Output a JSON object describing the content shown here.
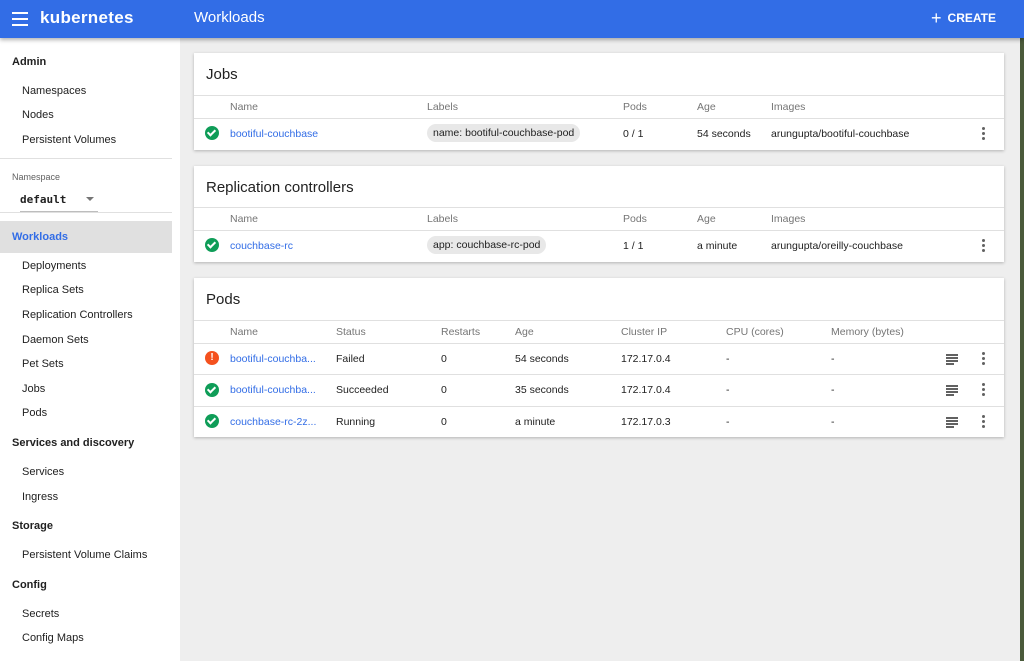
{
  "app": {
    "logo": "kubernetes",
    "page_title": "Workloads",
    "create_label": "CREATE"
  },
  "sidebar": {
    "admin": {
      "title": "Admin",
      "items": [
        "Namespaces",
        "Nodes",
        "Persistent Volumes"
      ]
    },
    "namespace": {
      "label": "Namespace",
      "value": "default"
    },
    "workloads": {
      "title": "Workloads",
      "items": [
        "Deployments",
        "Replica Sets",
        "Replication Controllers",
        "Daemon Sets",
        "Pet Sets",
        "Jobs",
        "Pods"
      ]
    },
    "services": {
      "title": "Services and discovery",
      "items": [
        "Services",
        "Ingress"
      ]
    },
    "storage": {
      "title": "Storage",
      "items": [
        "Persistent Volume Claims"
      ]
    },
    "config": {
      "title": "Config",
      "items": [
        "Secrets",
        "Config Maps"
      ]
    }
  },
  "jobs": {
    "title": "Jobs",
    "headers": [
      "Name",
      "Labels",
      "Pods",
      "Age",
      "Images"
    ],
    "rows": [
      {
        "status": "ok",
        "name": "bootiful-couchbase",
        "labels": "name: bootiful-couchbase-pod",
        "pods": "0 / 1",
        "age": "54 seconds",
        "images": "arungupta/bootiful-couchbase"
      }
    ]
  },
  "rcs": {
    "title": "Replication controllers",
    "headers": [
      "Name",
      "Labels",
      "Pods",
      "Age",
      "Images"
    ],
    "rows": [
      {
        "status": "ok",
        "name": "couchbase-rc",
        "labels": "app: couchbase-rc-pod",
        "pods": "1 / 1",
        "age": "a minute",
        "images": "arungupta/oreilly-couchbase"
      }
    ]
  },
  "pods": {
    "title": "Pods",
    "headers": [
      "Name",
      "Status",
      "Restarts",
      "Age",
      "Cluster IP",
      "CPU (cores)",
      "Memory (bytes)"
    ],
    "rows": [
      {
        "status": "error",
        "status_glyph": "!",
        "name": "bootiful-couchba...",
        "state": "Failed",
        "restarts": "0",
        "age": "54 seconds",
        "ip": "172.17.0.4",
        "cpu": "-",
        "memory": "-"
      },
      {
        "status": "ok",
        "name": "bootiful-couchba...",
        "state": "Succeeded",
        "restarts": "0",
        "age": "35 seconds",
        "ip": "172.17.0.4",
        "cpu": "-",
        "memory": "-"
      },
      {
        "status": "ok",
        "name": "couchbase-rc-2z...",
        "state": "Running",
        "restarts": "0",
        "age": "a minute",
        "ip": "172.17.0.3",
        "cpu": "-",
        "memory": "-"
      }
    ]
  },
  "icons": {
    "menu": "menu-icon",
    "create": "plus-icon",
    "ok": "check-circle-icon",
    "error": "error-circle-icon",
    "more": "more-vert-icon",
    "logs": "logs-icon",
    "dropdown": "caret-down-icon"
  },
  "colors": {
    "brand": "#326de6",
    "ok": "#0f9d58",
    "error": "#f4511e",
    "background": "#eeeeee"
  }
}
